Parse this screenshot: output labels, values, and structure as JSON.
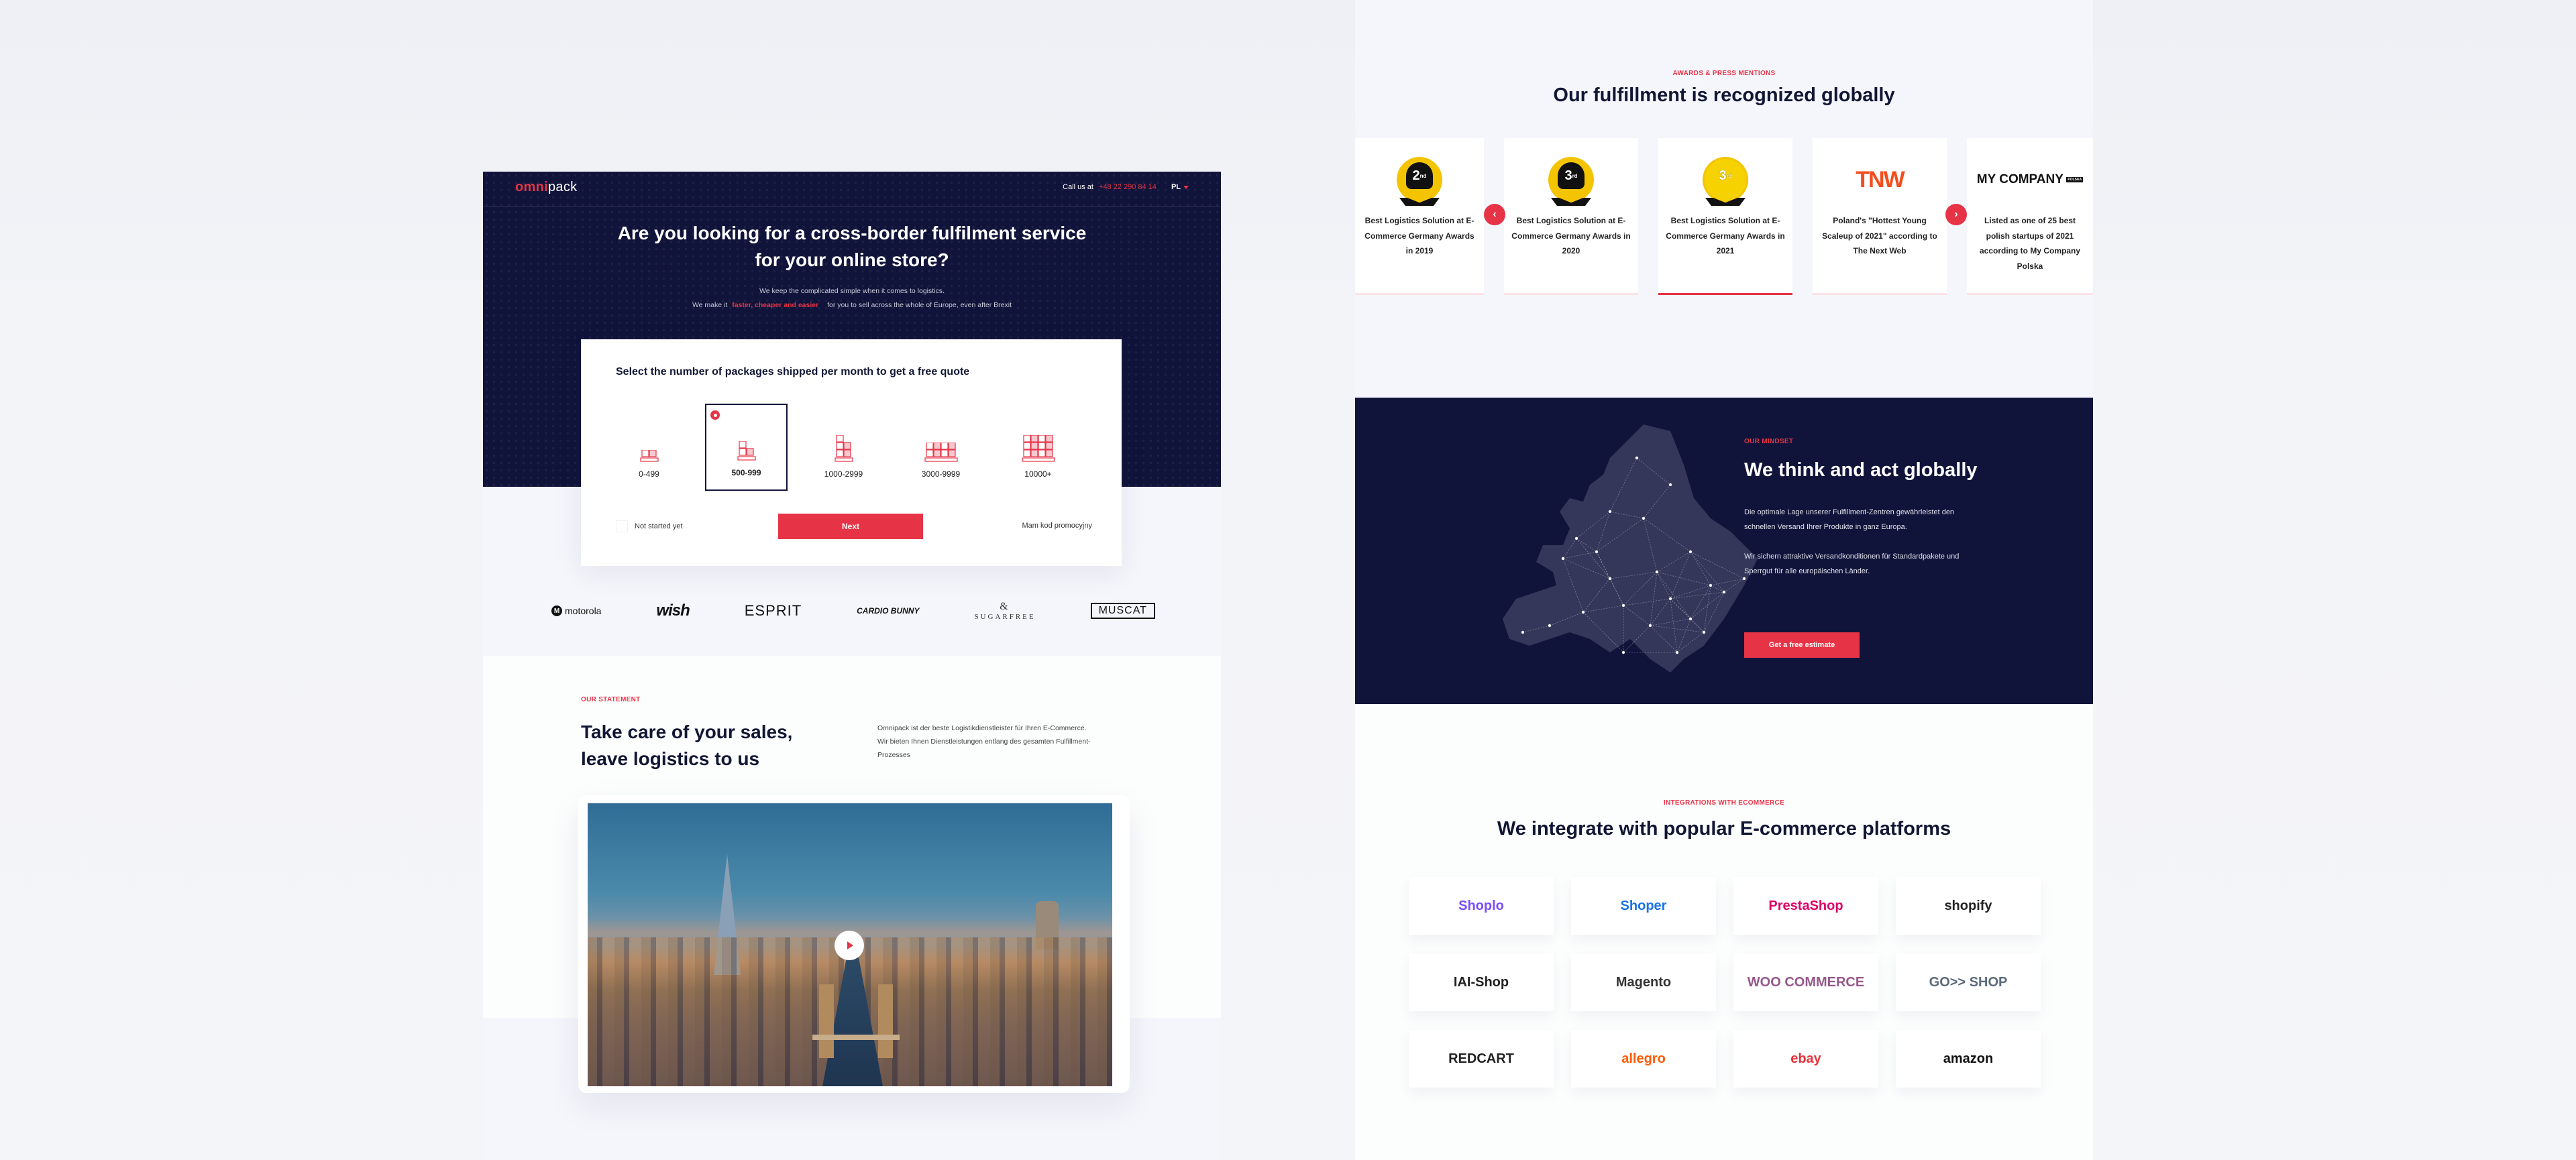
{
  "colors": {
    "accent": "#e63446",
    "navy": "#11143a",
    "page_bg": "#f5f6fc"
  },
  "left_page": {
    "header": {
      "logo_part1": "omni",
      "logo_part2": "pack",
      "call_label": "Call us at",
      "phone": "+48 22 290 84 14",
      "language": "PL",
      "language_icon": "chevron-down-icon"
    },
    "hero": {
      "title_line1": "Are you looking for a cross-border fulfilment service",
      "title_line2": "for your online store?",
      "sub_line1": "We keep the complicated simple when it comes to logistics.",
      "sub_line2_pre": "We make it",
      "sub_line2_highlight": "faster, cheaper and easier",
      "sub_line2_post": "for you to sell across the whole of Europe, even after Brexit"
    },
    "quote": {
      "title": "Select the number of packages shipped per month to get a free quote",
      "options": [
        {
          "label": "0-499",
          "selected": false
        },
        {
          "label": "500-999",
          "selected": true
        },
        {
          "label": "1000-2999",
          "selected": false
        },
        {
          "label": "3000-9999",
          "selected": false
        },
        {
          "label": "10000+",
          "selected": false
        }
      ],
      "checkbox_label": "Not started yet",
      "checkbox_checked": false,
      "next_label": "Next",
      "promo_label": "Mam kod promocyjny"
    },
    "brands": [
      "motorola",
      "wish",
      "ESPRIT",
      "CARDIO BUNNY",
      "SUGARFREE",
      "MUSCAT"
    ],
    "statement": {
      "eyebrow": "OUR STATEMENT",
      "title_line1": "Take care of your sales,",
      "title_line2": "leave logistics to us",
      "text": "Omnipack ist der beste Logistikdienstleister für Ihren E-Commerce. Wir bieten Ihnen Dienstleistungen entlang des gesamten Fulfillment-Prozesses"
    },
    "video": {
      "play_icon": "play-icon"
    }
  },
  "right_page": {
    "awards": {
      "eyebrow": "AWARDS & PRESS MENTIONS",
      "title": "Our fulfillment is recognized globally",
      "items": [
        {
          "logo": "2",
          "logo_sup": "nd",
          "text": "Best Logistics Solution at E-Commerce Germany Awards in 2019",
          "active": false
        },
        {
          "logo": "3",
          "logo_sup": "rd",
          "text": "Best Logistics Solution at E-Commerce Germany Awards in 2020",
          "active": false
        },
        {
          "logo": "3",
          "logo_sup": "rd",
          "text": "Best Logistics Solution at E-Commerce Germany Awards in 2021",
          "active": true
        },
        {
          "logo": "TNW",
          "logo_sup": "",
          "text": "Poland's \"Hottest Young Scaleup of 2021\" according to The Next Web",
          "active": false
        },
        {
          "logo": "MY COMPANY",
          "logo_sup": "POLSKA",
          "text": "Listed as one of 25 best polish startups of 2021 according to My Company Polska",
          "active": false
        }
      ],
      "prev_icon": "‹",
      "next_icon": "›"
    },
    "mindset": {
      "eyebrow": "OUR MINDSET",
      "title": "We think and act globally",
      "paragraph1": "Die optimale Lage unserer Fulfillment-Zentren gewährleistet den schnellen Versand Ihrer Produkte in ganz Europa.",
      "paragraph2": "Wir sichern attraktive Versandkonditionen für Standardpakete und Sperrgut für alle europäischen Länder.",
      "button_label": "Get a free estimate"
    },
    "integrations": {
      "eyebrow": "INTEGRATIONS WITH ECOMMERCE",
      "title": "We integrate with popular E-commerce platforms",
      "platforms": [
        {
          "name": "Shoplo",
          "color": "#7b4dff"
        },
        {
          "name": "Shoper",
          "color": "#1a73e8"
        },
        {
          "name": "PrestaShop",
          "color": "#df0067"
        },
        {
          "name": "shopify",
          "color": "#222222"
        },
        {
          "name": "IAI-Shop",
          "color": "#222222"
        },
        {
          "name": "Magento",
          "color": "#333333"
        },
        {
          "name": "WOO COMMERCE",
          "color": "#96588a"
        },
        {
          "name": "GO>> SHOP",
          "color": "#5b6b7b"
        },
        {
          "name": "REDCART",
          "color": "#222222"
        },
        {
          "name": "allegro",
          "color": "#ff5a00"
        },
        {
          "name": "ebay",
          "color": "#e53238"
        },
        {
          "name": "amazon",
          "color": "#111111"
        }
      ]
    }
  }
}
